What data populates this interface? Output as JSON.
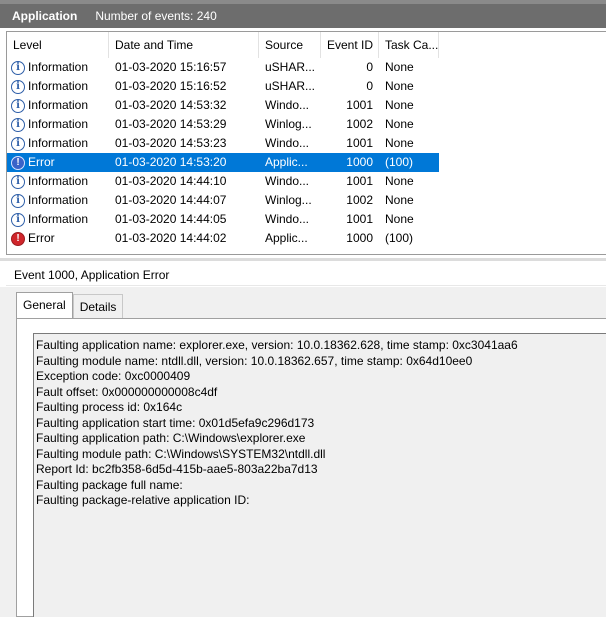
{
  "title": {
    "log_name": "Application",
    "event_count": "Number of events: 240"
  },
  "columns": {
    "level": "Level",
    "date": "Date and Time",
    "source": "Source",
    "event_id": "Event ID",
    "task": "Task Ca..."
  },
  "rows": [
    {
      "icon": "information-icon",
      "level": "Information",
      "date": "01-03-2020 15:16:57",
      "source": "uSHAR...",
      "event_id": "0",
      "task": "None"
    },
    {
      "icon": "information-icon",
      "level": "Information",
      "date": "01-03-2020 15:16:52",
      "source": "uSHAR...",
      "event_id": "0",
      "task": "None"
    },
    {
      "icon": "information-icon",
      "level": "Information",
      "date": "01-03-2020 14:53:32",
      "source": "Windo...",
      "event_id": "1001",
      "task": "None"
    },
    {
      "icon": "information-icon",
      "level": "Information",
      "date": "01-03-2020 14:53:29",
      "source": "Winlog...",
      "event_id": "1002",
      "task": "None"
    },
    {
      "icon": "information-icon",
      "level": "Information",
      "date": "01-03-2020 14:53:23",
      "source": "Windo...",
      "event_id": "1001",
      "task": "None"
    },
    {
      "icon": "error-icon",
      "level": "Error",
      "date": "01-03-2020 14:53:20",
      "source": "Applic...",
      "event_id": "1000",
      "task": "(100)",
      "selected": true
    },
    {
      "icon": "information-icon",
      "level": "Information",
      "date": "01-03-2020 14:44:10",
      "source": "Windo...",
      "event_id": "1001",
      "task": "None"
    },
    {
      "icon": "information-icon",
      "level": "Information",
      "date": "01-03-2020 14:44:07",
      "source": "Winlog...",
      "event_id": "1002",
      "task": "None"
    },
    {
      "icon": "information-icon",
      "level": "Information",
      "date": "01-03-2020 14:44:05",
      "source": "Windo...",
      "event_id": "1001",
      "task": "None"
    },
    {
      "icon": "error-icon",
      "level": "Error",
      "date": "01-03-2020 14:44:02",
      "source": "Applic...",
      "event_id": "1000",
      "task": "(100)"
    }
  ],
  "detail": {
    "header": "Event 1000, Application Error",
    "tabs": {
      "general": "General",
      "details": "Details"
    },
    "lines": [
      "Faulting application name: explorer.exe, version: 10.0.18362.628, time stamp: 0xc3041aa6",
      "Faulting module name: ntdll.dll, version: 10.0.18362.657, time stamp: 0x64d10ee0",
      "Exception code: 0xc0000409",
      "Fault offset: 0x000000000008c4df",
      "Faulting process id: 0x164c",
      "Faulting application start time: 0x01d5efa9c296d173",
      "Faulting application path: C:\\Windows\\explorer.exe",
      "Faulting module path: C:\\Windows\\SYSTEM32\\ntdll.dll",
      "Report Id: bc2fb358-6d5d-415b-aae5-803a22ba7d13",
      "Faulting package full name:",
      "Faulting package-relative application ID:"
    ]
  },
  "colors": {
    "selection": "#0078d7",
    "titlebar": "#6d6d6d",
    "error_icon": "#d0262b",
    "info_icon": "#2d5ea8"
  }
}
